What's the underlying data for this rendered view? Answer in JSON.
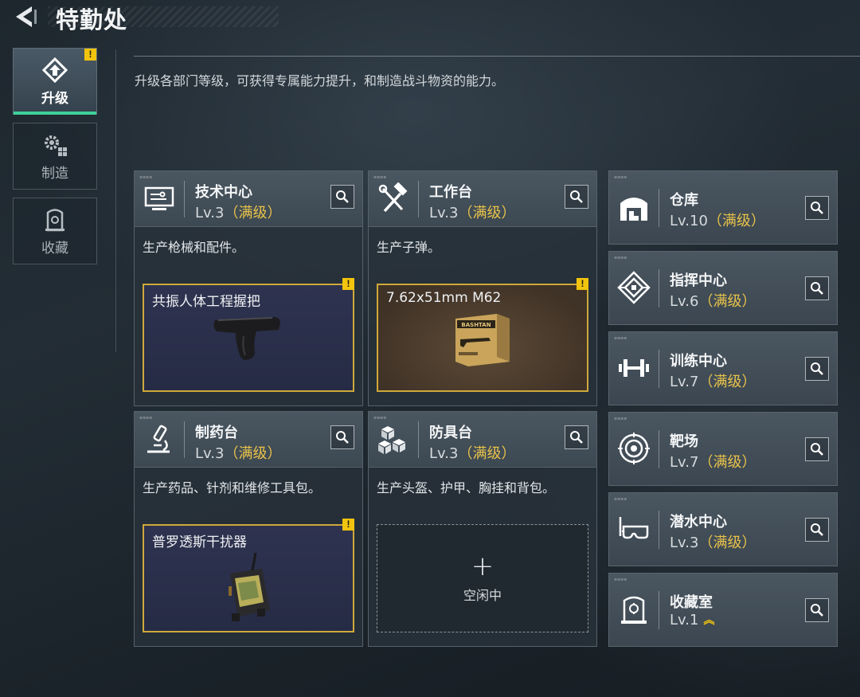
{
  "header": {
    "title": "特勤处"
  },
  "sidebar": {
    "tabs": [
      {
        "label": "升级",
        "icon": "upgrade-icon",
        "badge": "!"
      },
      {
        "label": "制造",
        "icon": "gears-icon"
      },
      {
        "label": "收藏",
        "icon": "collection-icon"
      }
    ]
  },
  "description": "升级各部门等级，可获得专属能力提升，和制造战斗物资的能力。",
  "cards": [
    {
      "name": "技术中心",
      "level": "Lv.3",
      "max": "（满级）",
      "desc": "生产枪械和配件。",
      "icon": "monitor-icon",
      "product": {
        "name": "共振人体工程握把",
        "badge": "!"
      }
    },
    {
      "name": "工作台",
      "level": "Lv.3",
      "max": "（满级）",
      "desc": "生产子弹。",
      "icon": "hammer-wrench-icon",
      "product": {
        "name": "7.62x51mm M62",
        "badge": "!",
        "box_text": "BASHTAN"
      }
    },
    {
      "name": "制药台",
      "level": "Lv.3",
      "max": "（满级）",
      "desc": "生产药品、针剂和维修工具包。",
      "icon": "microscope-icon",
      "product": {
        "name": "普罗透斯干扰器",
        "badge": "!"
      }
    },
    {
      "name": "防具台",
      "level": "Lv.3",
      "max": "（满级）",
      "desc": "生产头盔、护甲、胸挂和背包。",
      "icon": "cubes-icon",
      "idle": {
        "plus": "+",
        "label": "空闲中"
      }
    }
  ],
  "facilities": [
    {
      "name": "仓库",
      "level": "Lv.10",
      "max": "（满级）",
      "icon": "warehouse-icon"
    },
    {
      "name": "指挥中心",
      "level": "Lv.6",
      "max": "（满级）",
      "icon": "command-icon"
    },
    {
      "name": "训练中心",
      "level": "Lv.7",
      "max": "（满级）",
      "icon": "dumbbell-icon"
    },
    {
      "name": "靶场",
      "level": "Lv.7",
      "max": "（满级）",
      "icon": "target-icon"
    },
    {
      "name": "潜水中心",
      "level": "Lv.3",
      "max": "（满级）",
      "icon": "diving-mask-icon"
    },
    {
      "name": "收藏室",
      "level": "Lv.1",
      "max": "",
      "icon": "collection-room-icon",
      "upgradable": true
    }
  ],
  "colors": {
    "max_level": "#e9c34a",
    "warning": "#f2c40d",
    "active_tab": "#3fd09a",
    "product_border": "#cfa93a"
  }
}
